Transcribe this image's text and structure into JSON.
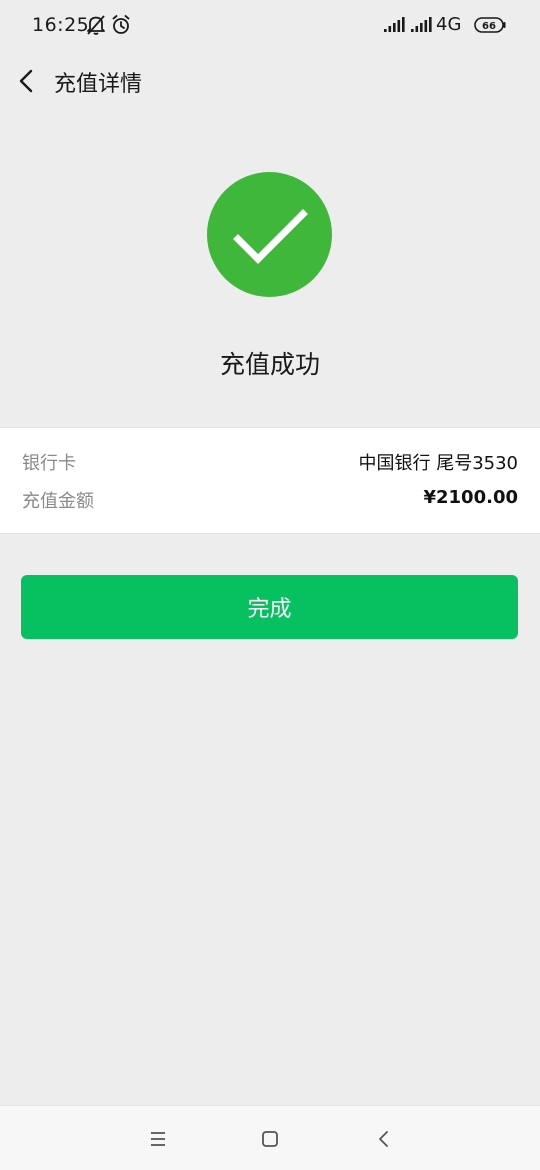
{
  "status_bar": {
    "time": "16:25",
    "network": "4G",
    "battery": "66"
  },
  "header": {
    "title": "充值详情"
  },
  "result": {
    "title": "充值成功",
    "color": "#3fb73a"
  },
  "details": {
    "rows": [
      {
        "label": "银行卡",
        "value": "中国银行 尾号3530"
      },
      {
        "label": "充值金额",
        "value": "¥2100.00"
      }
    ]
  },
  "actions": {
    "done_label": "完成",
    "accent": "#07c160"
  }
}
